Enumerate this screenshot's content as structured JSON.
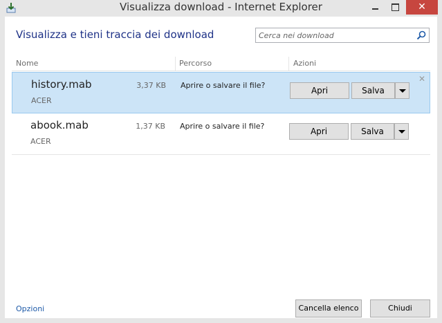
{
  "window": {
    "title": "Visualizza download - Internet Explorer",
    "close_glyph": "✕"
  },
  "header": {
    "title": "Visualizza e tieni traccia dei download"
  },
  "search": {
    "placeholder": "Cerca nei download"
  },
  "columns": {
    "name": "Nome",
    "path": "Percorso",
    "actions": "Azioni"
  },
  "downloads": [
    {
      "name": "history.mab",
      "source": "ACER",
      "size": "3,37 KB",
      "status": "Aprire o salvare il file?",
      "open_label": "Apri",
      "save_label": "Salva",
      "remove_glyph": "✕"
    },
    {
      "name": "abook.mab",
      "source": "ACER",
      "size": "1,37 KB",
      "status": "Aprire o salvare il file?",
      "open_label": "Apri",
      "save_label": "Salva"
    }
  ],
  "footer": {
    "options_link": "Opzioni",
    "clear_list_label": "Cancella elenco",
    "close_label": "Chiudi"
  },
  "colors": {
    "accent": "#1e3287",
    "selected_row": "#cce4f7",
    "close_button": "#c7463f",
    "link": "#1e5aa8"
  }
}
